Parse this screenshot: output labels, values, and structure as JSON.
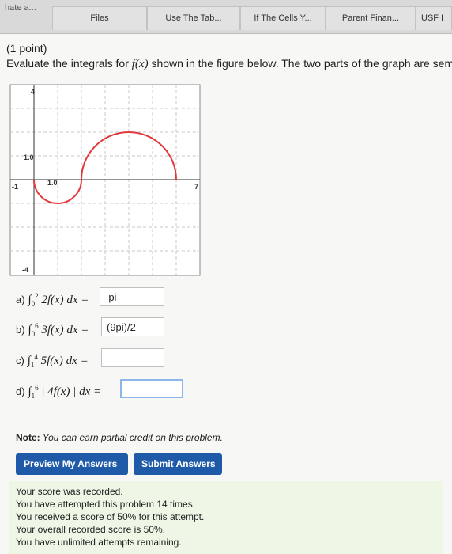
{
  "tabs": [
    "hate a...",
    "Files",
    "Use The Tab...",
    "If The Cells Y...",
    "Parent Finan...",
    "USF I"
  ],
  "problem": {
    "points": "(1 point)",
    "text_before": "Evaluate the integrals for ",
    "function": "f(x)",
    "text_after": " shown in the figure below. The two parts of the graph are semicir"
  },
  "graph": {
    "labels": {
      "y_top": "4",
      "y_mid": "1.0",
      "x_mid": "1.0",
      "x_left": "-1",
      "x_right": "7",
      "y_bottom": "-4"
    },
    "curve_color": "#e0393b"
  },
  "parts": [
    {
      "label": "a)",
      "lower": "0",
      "upper": "2",
      "integrand": "2f(x) dx =",
      "answer": "-pi"
    },
    {
      "label": "b)",
      "lower": "0",
      "upper": "6",
      "integrand": "3f(x) dx =",
      "answer": "(9pi)/2"
    },
    {
      "label": "c)",
      "lower": "1",
      "upper": "4",
      "integrand": "5f(x) dx =",
      "answer": ""
    },
    {
      "label": "d)",
      "lower": "1",
      "upper": "6",
      "integrand": "| 4f(x) | dx =",
      "answer": ""
    }
  ],
  "note": {
    "bold": "Note:",
    "text": " You can earn partial credit on this problem."
  },
  "buttons": {
    "preview": "Preview My Answers",
    "submit": "Submit Answers"
  },
  "feedback": [
    "Your score was recorded.",
    "You have attempted this problem 14 times.",
    "You received a score of 50% for this attempt.",
    "Your overall recorded score is 50%.",
    "You have unlimited attempts remaining."
  ]
}
